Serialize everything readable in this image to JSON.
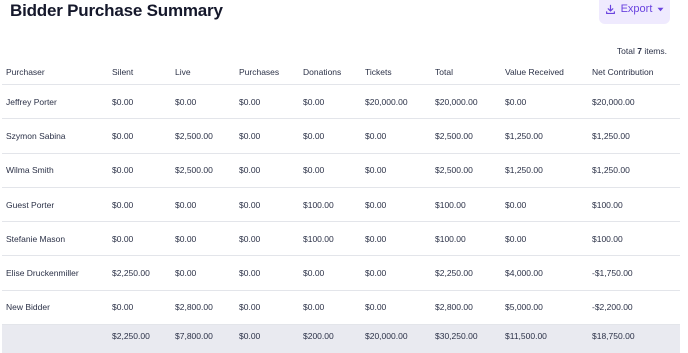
{
  "header": {
    "title": "Bidder Purchase Summary",
    "export_label": "Export",
    "export_icon": "download-icon",
    "export_caret_icon": "caret-down-icon",
    "accent_color": "#6a43df",
    "accent_bg": "#efeafe"
  },
  "meta": {
    "total_prefix": "Total",
    "total_count": "7",
    "total_suffix": "items."
  },
  "table": {
    "columns": [
      "Purchaser",
      "Silent",
      "Live",
      "Purchases",
      "Donations",
      "Tickets",
      "Total",
      "Value Received",
      "Net Contribution"
    ],
    "rows": [
      [
        "Jeffrey Porter",
        "$0.00",
        "$0.00",
        "$0.00",
        "$0.00",
        "$20,000.00",
        "$20,000.00",
        "$0.00",
        "$20,000.00"
      ],
      [
        "Szymon Sabina",
        "$0.00",
        "$2,500.00",
        "$0.00",
        "$0.00",
        "$0.00",
        "$2,500.00",
        "$1,250.00",
        "$1,250.00"
      ],
      [
        "Wilma Smith",
        "$0.00",
        "$2,500.00",
        "$0.00",
        "$0.00",
        "$0.00",
        "$2,500.00",
        "$1,250.00",
        "$1,250.00"
      ],
      [
        "Guest Porter",
        "$0.00",
        "$0.00",
        "$0.00",
        "$100.00",
        "$0.00",
        "$100.00",
        "$0.00",
        "$100.00"
      ],
      [
        "Stefanie Mason",
        "$0.00",
        "$0.00",
        "$0.00",
        "$100.00",
        "$0.00",
        "$100.00",
        "$0.00",
        "$100.00"
      ],
      [
        "Elise Druckenmiller",
        "$2,250.00",
        "$0.00",
        "$0.00",
        "$0.00",
        "$0.00",
        "$2,250.00",
        "$4,000.00",
        "-$1,750.00"
      ],
      [
        "New Bidder",
        "$0.00",
        "$2,800.00",
        "$0.00",
        "$0.00",
        "$0.00",
        "$2,800.00",
        "$5,000.00",
        "-$2,200.00"
      ]
    ],
    "totals": [
      "",
      "$2,250.00",
      "$7,800.00",
      "$0.00",
      "$200.00",
      "$20,000.00",
      "$30,250.00",
      "$11,500.00",
      "$18,750.00"
    ]
  }
}
